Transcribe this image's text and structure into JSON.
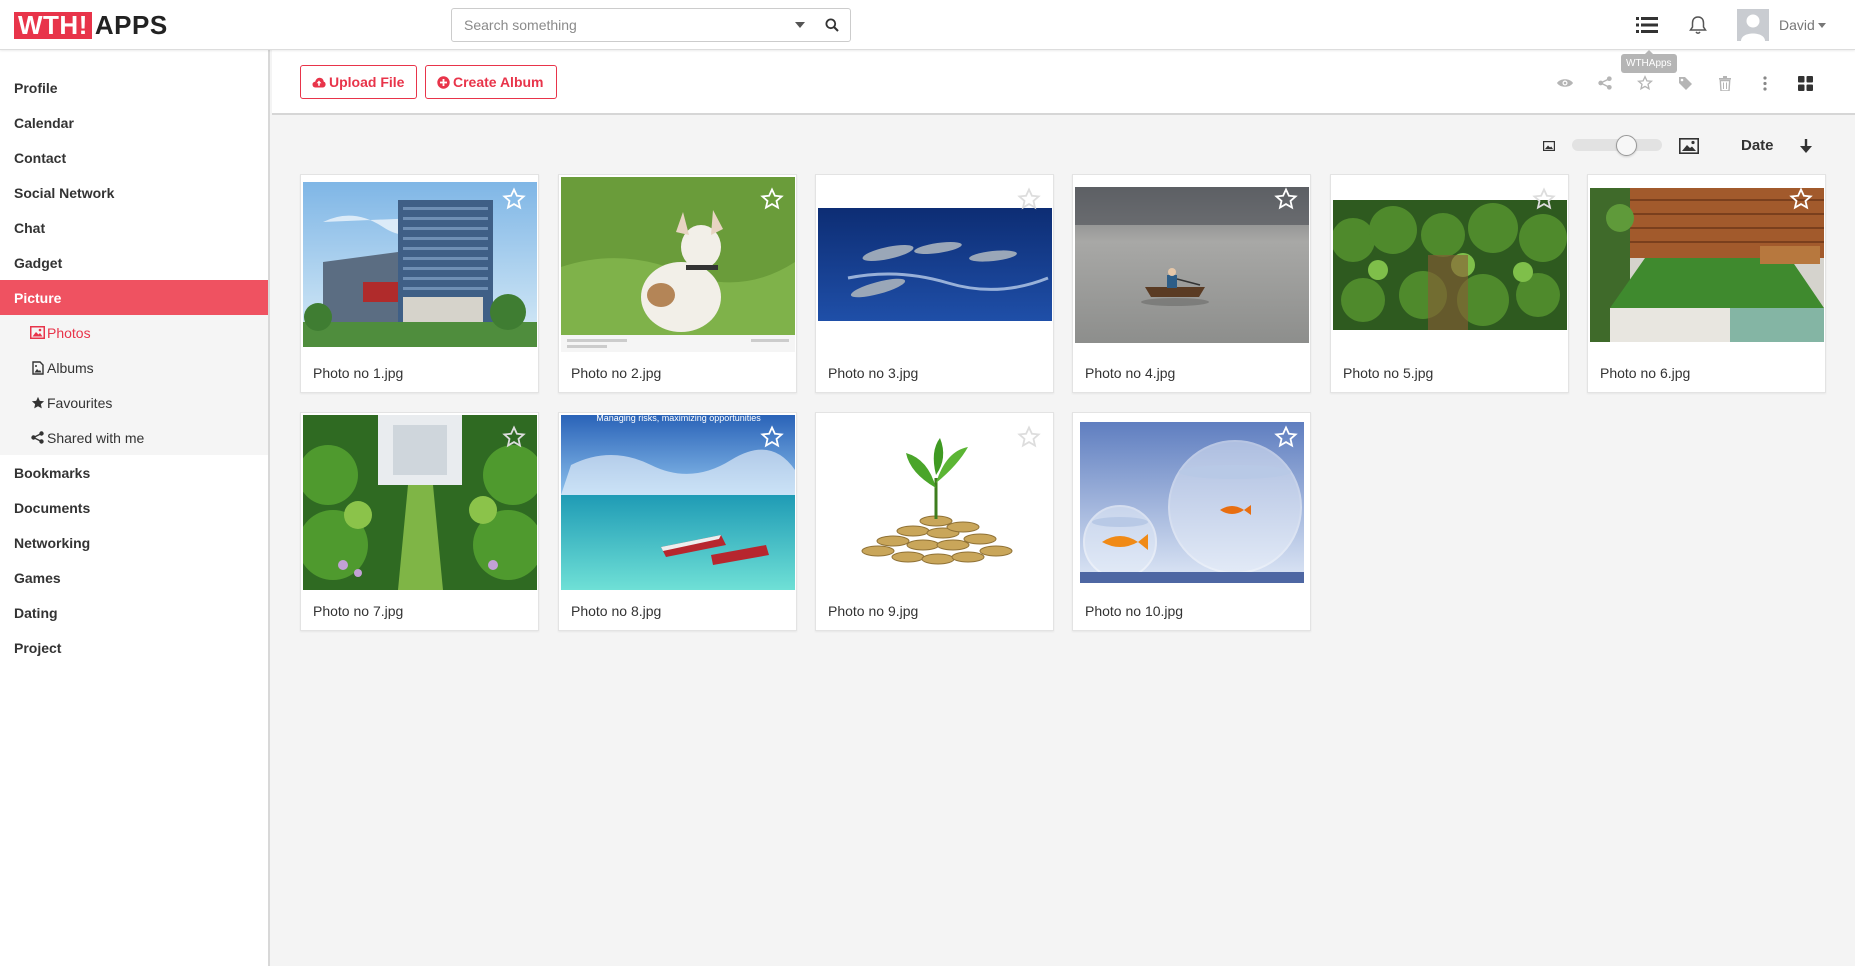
{
  "brand": {
    "logo_box": "WTH!",
    "logo_rest": "APPS",
    "accent": "#e8344a"
  },
  "search": {
    "placeholder": "Search something"
  },
  "user": {
    "name": "David"
  },
  "sidebar": {
    "items": [
      {
        "label": "Profile"
      },
      {
        "label": "Calendar"
      },
      {
        "label": "Contact"
      },
      {
        "label": "Social Network"
      },
      {
        "label": "Chat"
      },
      {
        "label": "Gadget"
      },
      {
        "label": "Picture",
        "active": true
      }
    ],
    "sub_items": [
      {
        "label": "Photos",
        "icon": "image-icon",
        "active": true
      },
      {
        "label": "Albums",
        "icon": "album-icon"
      },
      {
        "label": "Favourites",
        "icon": "star-icon"
      },
      {
        "label": "Shared with me",
        "icon": "share-icon"
      }
    ],
    "items_after": [
      {
        "label": "Bookmarks"
      },
      {
        "label": "Documents"
      },
      {
        "label": "Networking"
      },
      {
        "label": "Games"
      },
      {
        "label": "Dating"
      },
      {
        "label": "Project"
      }
    ]
  },
  "toolbar": {
    "upload_label": "Upload File",
    "create_album_label": "Create Album",
    "tooltip": "WTHApps",
    "icons": [
      "eye-icon",
      "share-icon",
      "star-icon",
      "tag-icon",
      "trash-icon",
      "more-icon",
      "grid-view-icon"
    ]
  },
  "view": {
    "sort_label": "Date",
    "sort_direction": "descending",
    "zoom_level": 0.5
  },
  "photos": [
    {
      "name": "Photo no 1.jpg"
    },
    {
      "name": "Photo no 2.jpg"
    },
    {
      "name": "Photo no 3.jpg"
    },
    {
      "name": "Photo no 4.jpg"
    },
    {
      "name": "Photo no 5.jpg"
    },
    {
      "name": "Photo no 6.jpg"
    },
    {
      "name": "Photo no 7.jpg"
    },
    {
      "name": "Photo no 8.jpg",
      "overlay_text": "Managing risks, maximizing opportunities"
    },
    {
      "name": "Photo no 9.jpg"
    },
    {
      "name": "Photo no 10.jpg"
    }
  ]
}
